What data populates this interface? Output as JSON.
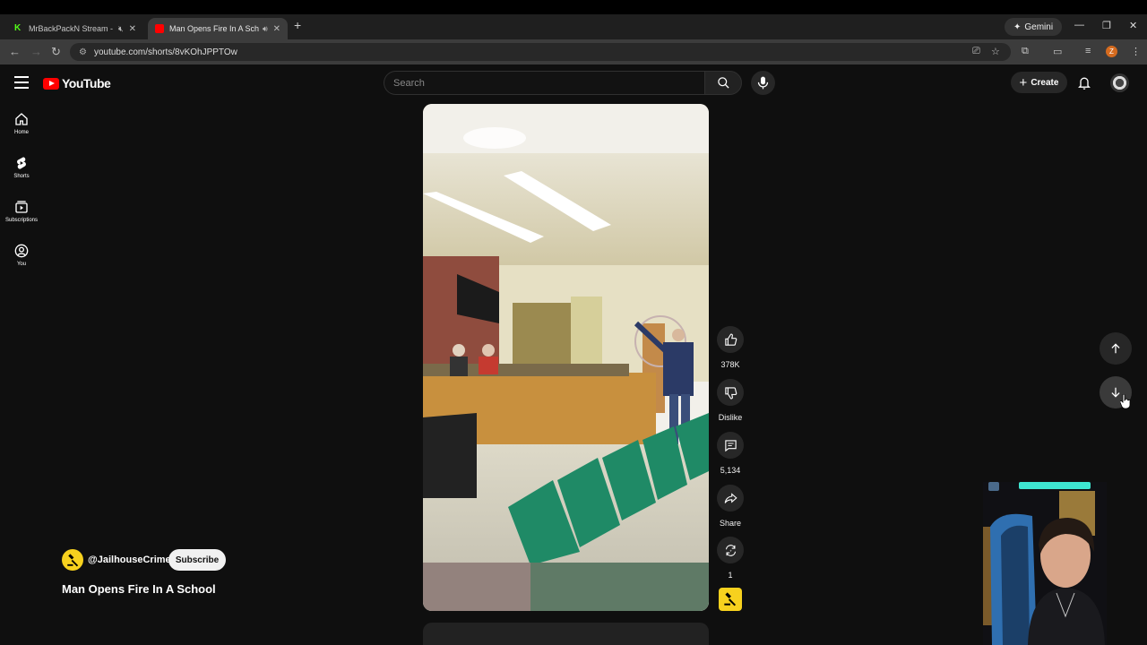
{
  "browser": {
    "tabs": [
      {
        "title": "MrBackPackN Stream - Wa",
        "favicon_color": "#53fc18",
        "active": false
      },
      {
        "title": "Man Opens Fire In A Schoo",
        "favicon_color": "#ff0000",
        "active": true
      }
    ],
    "gemini_label": "Gemini",
    "url": "youtube.com/shorts/8vKOhJPPTOw",
    "profile_initial": "Z"
  },
  "header": {
    "logo_text": "YouTube",
    "search_placeholder": "Search",
    "create_label": "Create"
  },
  "sidebar": {
    "items": [
      {
        "label": "Home",
        "icon": "home-icon"
      },
      {
        "label": "Shorts",
        "icon": "shorts-icon"
      },
      {
        "label": "Subscriptions",
        "icon": "subscriptions-icon"
      },
      {
        "label": "You",
        "icon": "you-icon"
      }
    ]
  },
  "short": {
    "channel": "@JailhouseCrime",
    "subscribe_label": "Subscribe",
    "title": "Man Opens Fire In A School",
    "likes": "378K",
    "dislike_label": "Dislike",
    "comments": "5,134",
    "share_label": "Share",
    "remix_count": "1"
  },
  "colors": {
    "background": "#0f0f0f",
    "brand_red": "#ff0000",
    "channel_yellow": "#f7d11e",
    "surface": "#272727"
  }
}
